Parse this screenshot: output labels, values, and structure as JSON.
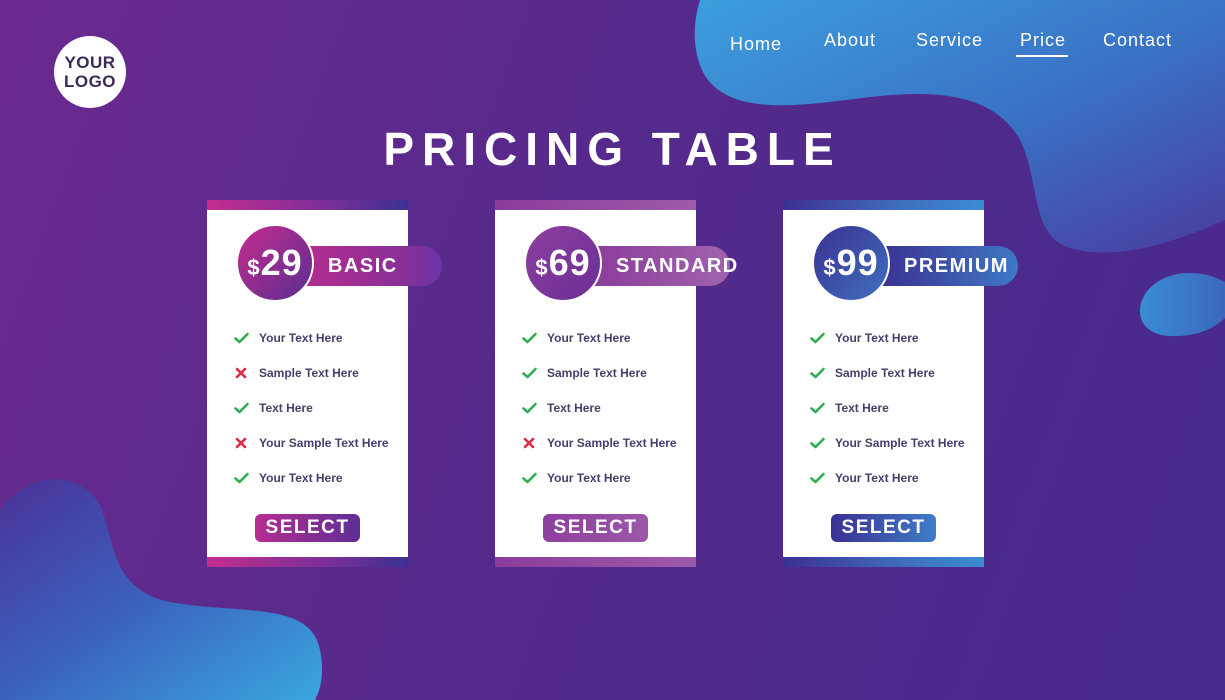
{
  "logo": {
    "line1": "YOUR",
    "line2": "LOGO"
  },
  "nav": {
    "items": [
      {
        "label": "Home",
        "active": false
      },
      {
        "label": "About",
        "active": false
      },
      {
        "label": "Service",
        "active": false
      },
      {
        "label": "Price",
        "active": true
      },
      {
        "label": "Contact",
        "active": false
      }
    ]
  },
  "title": "PRICING TABLE",
  "plans": [
    {
      "currency": "$",
      "price": "29",
      "name": "BASIC",
      "button": "SELECT",
      "features": [
        {
          "text": "Your Text Here",
          "included": true
        },
        {
          "text": "Sample Text Here",
          "included": false
        },
        {
          "text": "Text Here",
          "included": true
        },
        {
          "text": "Your Sample Text Here",
          "included": false
        },
        {
          "text": "Your Text Here",
          "included": true
        }
      ]
    },
    {
      "currency": "$",
      "price": "69",
      "name": "STANDARD",
      "button": "SELECT",
      "features": [
        {
          "text": "Your Text Here",
          "included": true
        },
        {
          "text": "Sample Text Here",
          "included": true
        },
        {
          "text": "Text Here",
          "included": true
        },
        {
          "text": "Your Sample Text Here",
          "included": false
        },
        {
          "text": "Your Text Here",
          "included": true
        }
      ]
    },
    {
      "currency": "$",
      "price": "99",
      "name": "PREMIUM",
      "button": "SELECT",
      "features": [
        {
          "text": "Your Text Here",
          "included": true
        },
        {
          "text": "Sample Text Here",
          "included": true
        },
        {
          "text": "Text Here",
          "included": true
        },
        {
          "text": "Your Sample Text Here",
          "included": true
        },
        {
          "text": "Your Text Here",
          "included": true
        }
      ]
    }
  ],
  "colors": {
    "background": "#55288a",
    "check": "#2fae52",
    "cross": "#e0293f",
    "blob_blue": "#3a8cd3"
  },
  "icons": {
    "included": "check-icon",
    "excluded": "cross-icon"
  }
}
